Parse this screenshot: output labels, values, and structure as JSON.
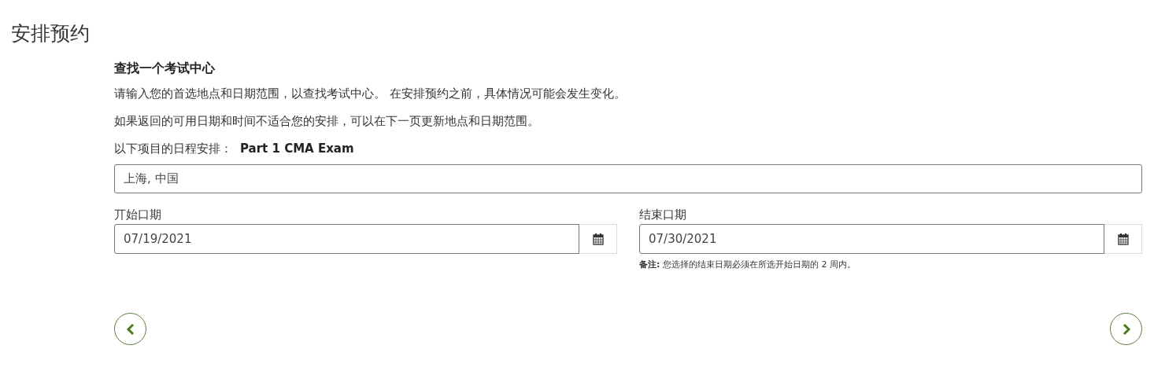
{
  "page_title": "安排预约",
  "section": {
    "heading": "查找一个考试中心",
    "paragraphs": [
      "请输入您的首选地点和日期范围，以查找考试中心。 在安排预约之前，具体情况可能会发生变化。",
      "如果返回的可用日期和时间不适合您的安排，可以在下一页更新地点和日期范围。"
    ],
    "schedule_label": "以下项目的日程安排：",
    "schedule_item": "Part 1 CMA Exam",
    "location": {
      "value": "上海, 中国"
    },
    "dates": [
      {
        "label": "丌始口期",
        "value": "07/19/2021"
      },
      {
        "label": "结束口期",
        "value": "07/30/2021",
        "note": "**备注:** 您选择的结束日期必须在所选开始日期的 2 周内。"
      }
    ]
  },
  "nav": [
    {
      "kind": "previous"
    },
    {
      "kind": "next"
    }
  ]
}
